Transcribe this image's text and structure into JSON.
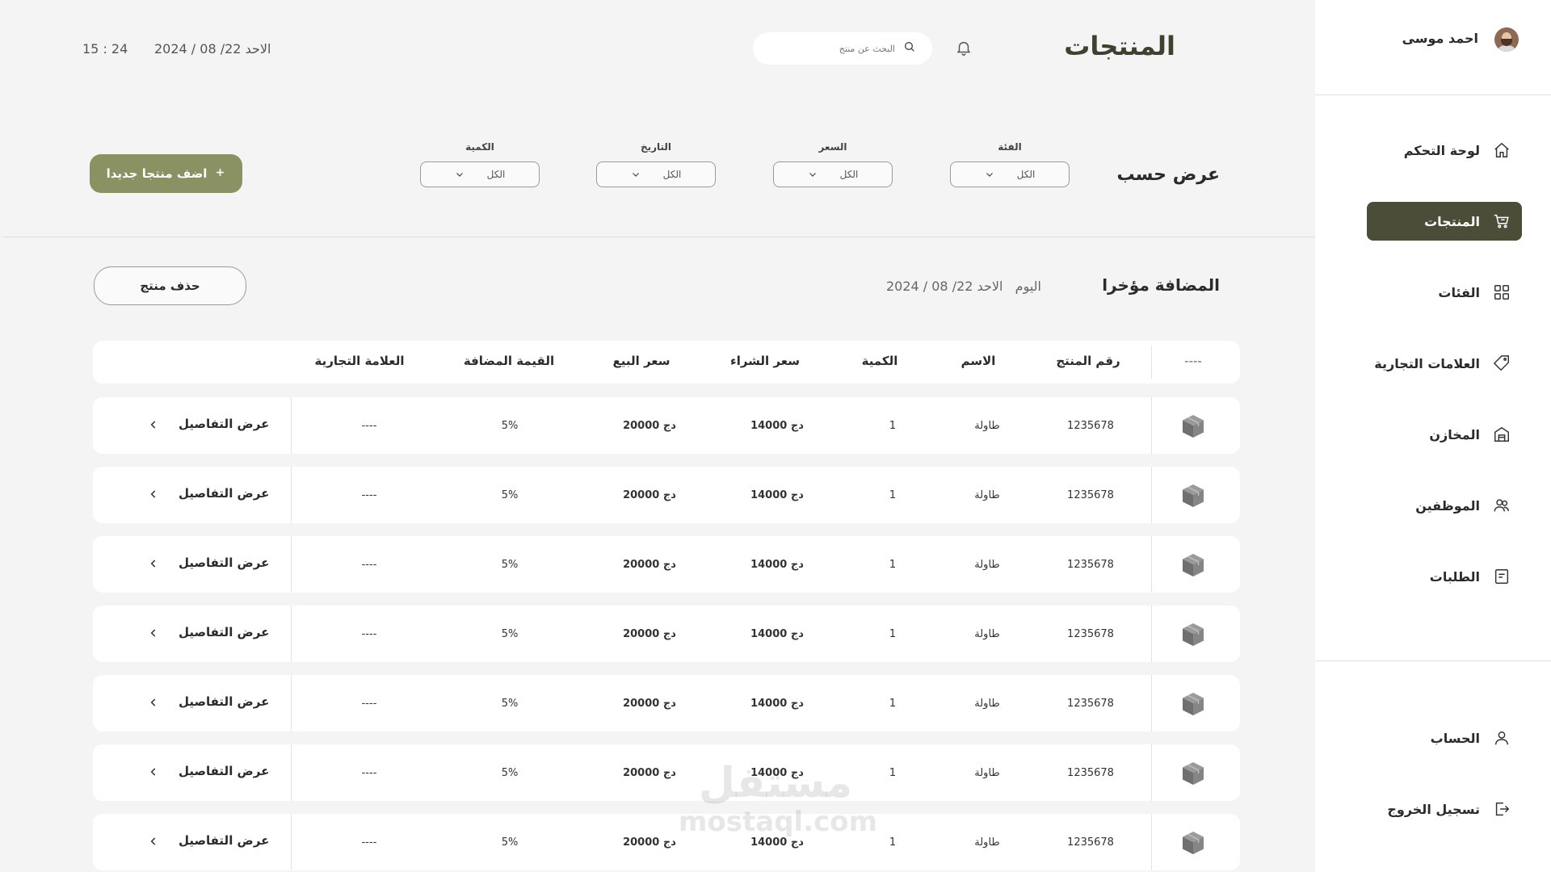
{
  "header": {
    "title": "المنتجات",
    "search_placeholder": "البحث عن منتج",
    "time": "15 : 24",
    "date": "الاحد 22/ 08 / 2024"
  },
  "profile": {
    "name": "احمد موسى"
  },
  "sidebar": {
    "items": [
      {
        "label": "لوحة التحكم",
        "icon": "home-icon"
      },
      {
        "label": "المنتجات",
        "icon": "cart-icon"
      },
      {
        "label": "الفئات",
        "icon": "grid-icon"
      },
      {
        "label": "العلامات التجارية",
        "icon": "tag-icon"
      },
      {
        "label": "المخازن",
        "icon": "warehouse-icon"
      },
      {
        "label": "الموظفين",
        "icon": "users-icon"
      },
      {
        "label": "الطلبات",
        "icon": "orders-icon"
      }
    ],
    "bottom": [
      {
        "label": "الحساب",
        "icon": "user-icon"
      },
      {
        "label": "تسجيل الخروج",
        "icon": "logout-icon"
      }
    ],
    "active_color": "#4b4d38"
  },
  "filters": {
    "title": "عرض حسب",
    "items": [
      {
        "label": "الفئة",
        "value": "الكل"
      },
      {
        "label": "السعر",
        "value": "الكل"
      },
      {
        "label": "التاريخ",
        "value": "الكل"
      },
      {
        "label": "الكمية",
        "value": "الكل"
      }
    ],
    "add_button": "اضف منتجا جديدا",
    "add_button_color": "#8a9163"
  },
  "recent": {
    "title": "المضافة مؤخرا",
    "today": "اليوم",
    "date": "الاحد 22/ 08 / 2024",
    "delete_button": "حذف منتج"
  },
  "table": {
    "icon_header": "----",
    "headers": [
      "رقم المنتج",
      "الاسم",
      "الكمية",
      "سعر الشراء",
      "سعر البيع",
      "القيمة المضافة",
      "العلامة التجارية"
    ],
    "details_label": "عرض التفاصيل",
    "rows": [
      {
        "id": "1235678",
        "name": "طاولة",
        "qty": "1",
        "buy": "14000 دج",
        "sell": "20000 دج",
        "vat": "5%",
        "brand": "----"
      },
      {
        "id": "1235678",
        "name": "طاولة",
        "qty": "1",
        "buy": "14000 دج",
        "sell": "20000 دج",
        "vat": "5%",
        "brand": "----"
      },
      {
        "id": "1235678",
        "name": "طاولة",
        "qty": "1",
        "buy": "14000 دج",
        "sell": "20000 دج",
        "vat": "5%",
        "brand": "----"
      },
      {
        "id": "1235678",
        "name": "طاولة",
        "qty": "1",
        "buy": "14000 دج",
        "sell": "20000 دج",
        "vat": "5%",
        "brand": "----"
      },
      {
        "id": "1235678",
        "name": "طاولة",
        "qty": "1",
        "buy": "14000 دج",
        "sell": "20000 دج",
        "vat": "5%",
        "brand": "----"
      },
      {
        "id": "1235678",
        "name": "طاولة",
        "qty": "1",
        "buy": "14000 دج",
        "sell": "20000 دج",
        "vat": "5%",
        "brand": "----"
      },
      {
        "id": "1235678",
        "name": "طاولة",
        "qty": "1",
        "buy": "14000 دج",
        "sell": "20000 دج",
        "vat": "5%",
        "brand": "----"
      }
    ]
  },
  "watermark": {
    "arabic": "مستقل",
    "latin": "mostaql.com"
  }
}
